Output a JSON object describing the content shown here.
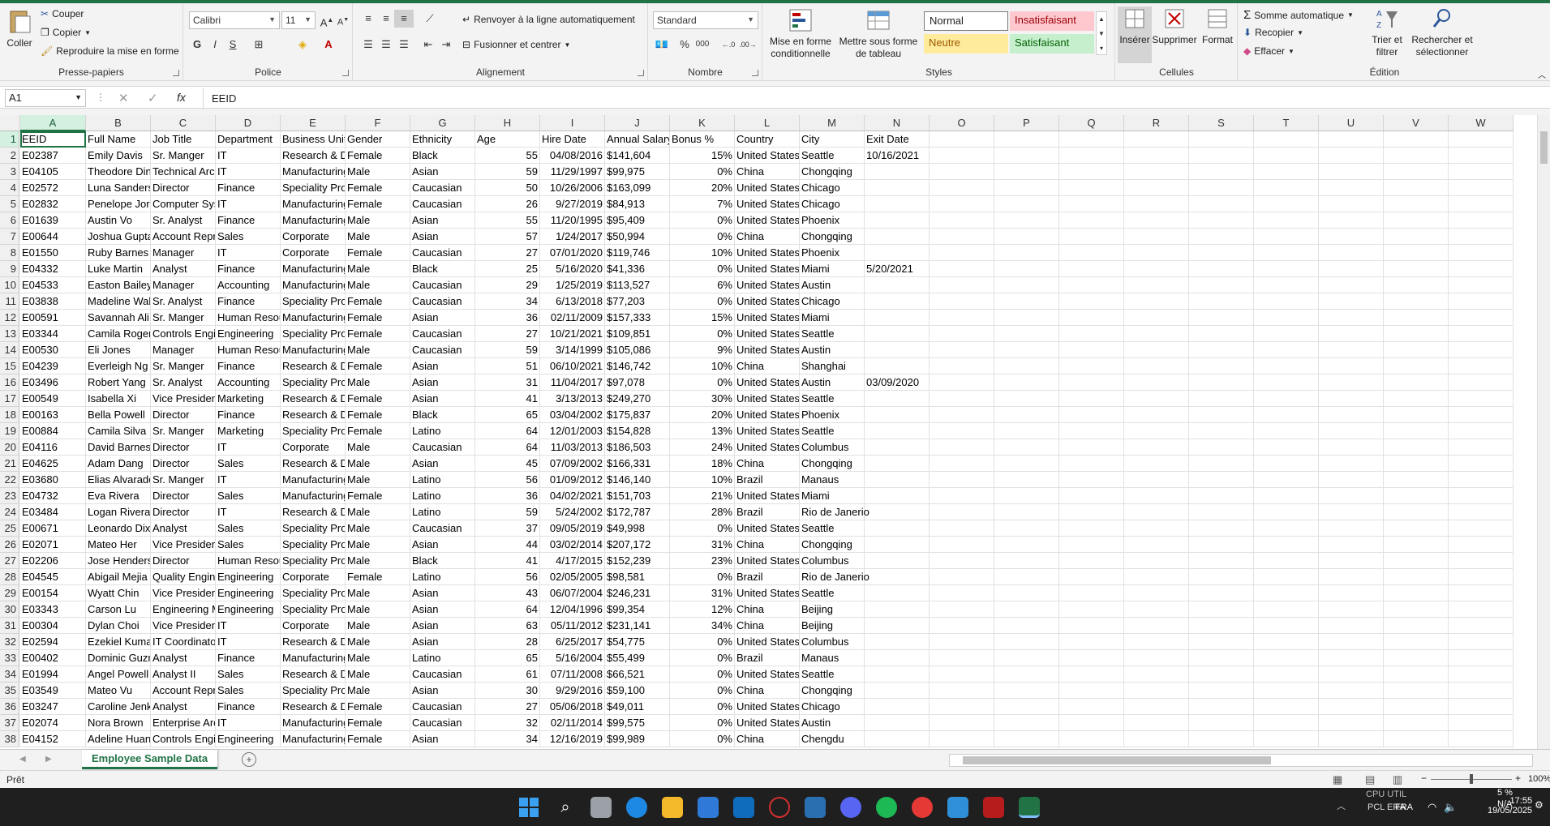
{
  "ribbon": {
    "clipboard": {
      "paste": "Coller",
      "cut": "Couper",
      "copy": "Copier",
      "format_painter": "Reproduire la mise en forme",
      "label": "Presse-papiers"
    },
    "font": {
      "name": "Calibri",
      "size": "11",
      "label": "Police"
    },
    "alignment": {
      "wrap": "Renvoyer à la ligne automatiquement",
      "merge": "Fusionner et centrer",
      "label": "Alignement"
    },
    "number": {
      "format": "Standard",
      "label": "Nombre",
      "percent": "%",
      "thousands": "000"
    },
    "styles": {
      "conditional": "Mise en forme conditionnelle",
      "table": "Mettre sous forme de tableau",
      "normal": "Normal",
      "bad": "Insatisfaisant",
      "neutral": "Neutre",
      "good": "Satisfaisant",
      "label": "Styles"
    },
    "cells": {
      "insert": "Insérer",
      "delete": "Supprimer",
      "format": "Format",
      "label": "Cellules"
    },
    "editing": {
      "autosum": "Somme automatique",
      "fill": "Recopier",
      "clear": "Effacer",
      "sort": "Trier et filtrer",
      "find": "Rechercher et sélectionner",
      "label": "Édition"
    }
  },
  "formula_bar": {
    "name_box": "A1",
    "fx": "fx",
    "value": "EEID"
  },
  "columns": [
    "A",
    "B",
    "C",
    "D",
    "E",
    "F",
    "G",
    "H",
    "I",
    "J",
    "K",
    "L",
    "M",
    "N",
    "O",
    "P",
    "Q",
    "R",
    "S",
    "T",
    "U",
    "V",
    "W"
  ],
  "rows": [
    [
      "EEID",
      "Full Name",
      "Job Title",
      "Department",
      "Business Unit",
      "Gender",
      "Ethnicity",
      "Age",
      "Hire Date",
      "Annual Salary",
      "Bonus %",
      "Country",
      "City",
      "Exit Date"
    ],
    [
      "E02387",
      "Emily Davis",
      "Sr. Manger",
      "IT",
      "Research & Development",
      "Female",
      "Black",
      "55",
      "04/08/2016",
      "$141,604",
      "15%",
      "United States",
      "Seattle",
      "10/16/2021"
    ],
    [
      "E04105",
      "Theodore Dinh",
      "Technical Architect",
      "IT",
      "Manufacturing",
      "Male",
      "Asian",
      "59",
      "11/29/1997",
      "$99,975",
      "0%",
      "China",
      "Chongqing",
      ""
    ],
    [
      "E02572",
      "Luna Sanders",
      "Director",
      "Finance",
      "Speciality Products",
      "Female",
      "Caucasian",
      "50",
      "10/26/2006",
      "$163,099",
      "20%",
      "United States",
      "Chicago",
      ""
    ],
    [
      "E02832",
      "Penelope Jordan",
      "Computer Systems Manager",
      "IT",
      "Manufacturing",
      "Female",
      "Caucasian",
      "26",
      "9/27/2019",
      "$84,913",
      "7%",
      "United States",
      "Chicago",
      ""
    ],
    [
      "E01639",
      "Austin Vo",
      "Sr. Analyst",
      "Finance",
      "Manufacturing",
      "Male",
      "Asian",
      "55",
      "11/20/1995",
      "$95,409",
      "0%",
      "United States",
      "Phoenix",
      ""
    ],
    [
      "E00644",
      "Joshua Gupta",
      "Account Representative",
      "Sales",
      "Corporate",
      "Male",
      "Asian",
      "57",
      "1/24/2017",
      "$50,994",
      "0%",
      "China",
      "Chongqing",
      ""
    ],
    [
      "E01550",
      "Ruby Barnes",
      "Manager",
      "IT",
      "Corporate",
      "Female",
      "Caucasian",
      "27",
      "07/01/2020",
      "$119,746",
      "10%",
      "United States",
      "Phoenix",
      ""
    ],
    [
      "E04332",
      "Luke Martin",
      "Analyst",
      "Finance",
      "Manufacturing",
      "Male",
      "Black",
      "25",
      "5/16/2020",
      "$41,336",
      "0%",
      "United States",
      "Miami",
      "5/20/2021"
    ],
    [
      "E04533",
      "Easton Bailey",
      "Manager",
      "Accounting",
      "Manufacturing",
      "Male",
      "Caucasian",
      "29",
      "1/25/2019",
      "$113,527",
      "6%",
      "United States",
      "Austin",
      ""
    ],
    [
      "E03838",
      "Madeline Walker",
      "Sr. Analyst",
      "Finance",
      "Speciality Products",
      "Female",
      "Caucasian",
      "34",
      "6/13/2018",
      "$77,203",
      "0%",
      "United States",
      "Chicago",
      ""
    ],
    [
      "E00591",
      "Savannah Ali",
      "Sr. Manger",
      "Human Resources",
      "Manufacturing",
      "Female",
      "Asian",
      "36",
      "02/11/2009",
      "$157,333",
      "15%",
      "United States",
      "Miami",
      ""
    ],
    [
      "E03344",
      "Camila Rogers",
      "Controls Engineer",
      "Engineering",
      "Speciality Products",
      "Female",
      "Caucasian",
      "27",
      "10/21/2021",
      "$109,851",
      "0%",
      "United States",
      "Seattle",
      ""
    ],
    [
      "E00530",
      "Eli Jones",
      "Manager",
      "Human Resources",
      "Manufacturing",
      "Male",
      "Caucasian",
      "59",
      "3/14/1999",
      "$105,086",
      "9%",
      "United States",
      "Austin",
      ""
    ],
    [
      "E04239",
      "Everleigh Ng",
      "Sr. Manger",
      "Finance",
      "Research & Development",
      "Female",
      "Asian",
      "51",
      "06/10/2021",
      "$146,742",
      "10%",
      "China",
      "Shanghai",
      ""
    ],
    [
      "E03496",
      "Robert Yang",
      "Sr. Analyst",
      "Accounting",
      "Speciality Products",
      "Male",
      "Asian",
      "31",
      "11/04/2017",
      "$97,078",
      "0%",
      "United States",
      "Austin",
      "03/09/2020"
    ],
    [
      "E00549",
      "Isabella Xi",
      "Vice President",
      "Marketing",
      "Research & Development",
      "Female",
      "Asian",
      "41",
      "3/13/2013",
      "$249,270",
      "30%",
      "United States",
      "Seattle",
      ""
    ],
    [
      "E00163",
      "Bella Powell",
      "Director",
      "Finance",
      "Research & Development",
      "Female",
      "Black",
      "65",
      "03/04/2002",
      "$175,837",
      "20%",
      "United States",
      "Phoenix",
      ""
    ],
    [
      "E00884",
      "Camila Silva",
      "Sr. Manger",
      "Marketing",
      "Speciality Products",
      "Female",
      "Latino",
      "64",
      "12/01/2003",
      "$154,828",
      "13%",
      "United States",
      "Seattle",
      ""
    ],
    [
      "E04116",
      "David Barnes",
      "Director",
      "IT",
      "Corporate",
      "Male",
      "Caucasian",
      "64",
      "11/03/2013",
      "$186,503",
      "24%",
      "United States",
      "Columbus",
      ""
    ],
    [
      "E04625",
      "Adam Dang",
      "Director",
      "Sales",
      "Research & Development",
      "Male",
      "Asian",
      "45",
      "07/09/2002",
      "$166,331",
      "18%",
      "China",
      "Chongqing",
      ""
    ],
    [
      "E03680",
      "Elias Alvarado",
      "Sr. Manger",
      "IT",
      "Manufacturing",
      "Male",
      "Latino",
      "56",
      "01/09/2012",
      "$146,140",
      "10%",
      "Brazil",
      "Manaus",
      ""
    ],
    [
      "E04732",
      "Eva Rivera",
      "Director",
      "Sales",
      "Manufacturing",
      "Female",
      "Latino",
      "36",
      "04/02/2021",
      "$151,703",
      "21%",
      "United States",
      "Miami",
      ""
    ],
    [
      "E03484",
      "Logan Rivera",
      "Director",
      "IT",
      "Research & Development",
      "Male",
      "Latino",
      "59",
      "5/24/2002",
      "$172,787",
      "28%",
      "Brazil",
      "Rio de Janerio",
      ""
    ],
    [
      "E00671",
      "Leonardo Dixon",
      "Analyst",
      "Sales",
      "Speciality Products",
      "Male",
      "Caucasian",
      "37",
      "09/05/2019",
      "$49,998",
      "0%",
      "United States",
      "Seattle",
      ""
    ],
    [
      "E02071",
      "Mateo Her",
      "Vice President",
      "Sales",
      "Speciality Products",
      "Male",
      "Asian",
      "44",
      "03/02/2014",
      "$207,172",
      "31%",
      "China",
      "Chongqing",
      ""
    ],
    [
      "E02206",
      "Jose Henderson",
      "Director",
      "Human Resources",
      "Speciality Products",
      "Male",
      "Black",
      "41",
      "4/17/2015",
      "$152,239",
      "23%",
      "United States",
      "Columbus",
      ""
    ],
    [
      "E04545",
      "Abigail Mejia",
      "Quality Engineer",
      "Engineering",
      "Corporate",
      "Female",
      "Latino",
      "56",
      "02/05/2005",
      "$98,581",
      "0%",
      "Brazil",
      "Rio de Janerio",
      ""
    ],
    [
      "E00154",
      "Wyatt Chin",
      "Vice President",
      "Engineering",
      "Speciality Products",
      "Male",
      "Asian",
      "43",
      "06/07/2004",
      "$246,231",
      "31%",
      "United States",
      "Seattle",
      ""
    ],
    [
      "E03343",
      "Carson Lu",
      "Engineering Manager",
      "Engineering",
      "Speciality Products",
      "Male",
      "Asian",
      "64",
      "12/04/1996",
      "$99,354",
      "12%",
      "China",
      "Beijing",
      ""
    ],
    [
      "E00304",
      "Dylan Choi",
      "Vice President",
      "IT",
      "Corporate",
      "Male",
      "Asian",
      "63",
      "05/11/2012",
      "$231,141",
      "34%",
      "China",
      "Beijing",
      ""
    ],
    [
      "E02594",
      "Ezekiel Kumar",
      "IT Coordinator",
      "IT",
      "Research & Development",
      "Male",
      "Asian",
      "28",
      "6/25/2017",
      "$54,775",
      "0%",
      "United States",
      "Columbus",
      ""
    ],
    [
      "E00402",
      "Dominic Guzman",
      "Analyst",
      "Finance",
      "Manufacturing",
      "Male",
      "Latino",
      "65",
      "5/16/2004",
      "$55,499",
      "0%",
      "Brazil",
      "Manaus",
      ""
    ],
    [
      "E01994",
      "Angel Powell",
      "Analyst II",
      "Sales",
      "Research & Development",
      "Male",
      "Caucasian",
      "61",
      "07/11/2008",
      "$66,521",
      "0%",
      "United States",
      "Seattle",
      ""
    ],
    [
      "E03549",
      "Mateo Vu",
      "Account Representative",
      "Sales",
      "Speciality Products",
      "Male",
      "Asian",
      "30",
      "9/29/2016",
      "$59,100",
      "0%",
      "China",
      "Chongqing",
      ""
    ],
    [
      "E03247",
      "Caroline Jenkins",
      "Analyst",
      "Finance",
      "Research & Development",
      "Female",
      "Caucasian",
      "27",
      "05/06/2018",
      "$49,011",
      "0%",
      "United States",
      "Chicago",
      ""
    ],
    [
      "E02074",
      "Nora Brown",
      "Enterprise Architect",
      "IT",
      "Manufacturing",
      "Female",
      "Caucasian",
      "32",
      "02/11/2014",
      "$99,575",
      "0%",
      "United States",
      "Austin",
      ""
    ],
    [
      "E04152",
      "Adeline Huang",
      "Controls Engineer",
      "Engineering",
      "Manufacturing",
      "Female",
      "Asian",
      "34",
      "12/16/2019",
      "$99,989",
      "0%",
      "China",
      "Chengdu",
      ""
    ]
  ],
  "sheet_tab": "Employee Sample Data",
  "status": "Prêt",
  "zoom": "100%",
  "taskbar": {
    "time": "17:55",
    "date": "19/05/2025",
    "lang": "FRA",
    "overlay_cpu": "CPU UTIL",
    "overlay_pct": "5 %",
    "overlay_na": "N/A",
    "overlay_left": "PCL ERA"
  },
  "colors": {
    "excel_green": "#217346",
    "bad_bg": "#ffc7ce",
    "bad_fg": "#9c0006",
    "neutral_bg": "#ffeb9c",
    "neutral_fg": "#9c5700",
    "good_bg": "#c6efce",
    "good_fg": "#006100"
  }
}
